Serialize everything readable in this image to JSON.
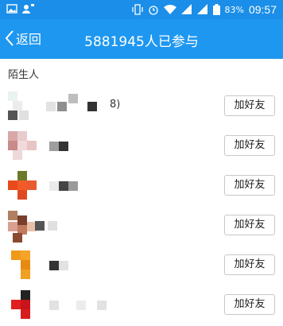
{
  "status_bar": {
    "battery": "83%",
    "time": "09:57"
  },
  "nav": {
    "back_label": "返回",
    "title": "5881945人已参与"
  },
  "section": {
    "title": "陌生人"
  },
  "rows": [
    {
      "add_label": "加好友",
      "name_suffix": "8)"
    },
    {
      "add_label": "加好友"
    },
    {
      "add_label": "加好友"
    },
    {
      "add_label": "加好友"
    },
    {
      "add_label": "加好友"
    },
    {
      "add_label": "加好友"
    }
  ],
  "colors": {
    "status_bar": "#1a8ee8",
    "nav_bar": "#1e97f0",
    "text": "#333333"
  }
}
